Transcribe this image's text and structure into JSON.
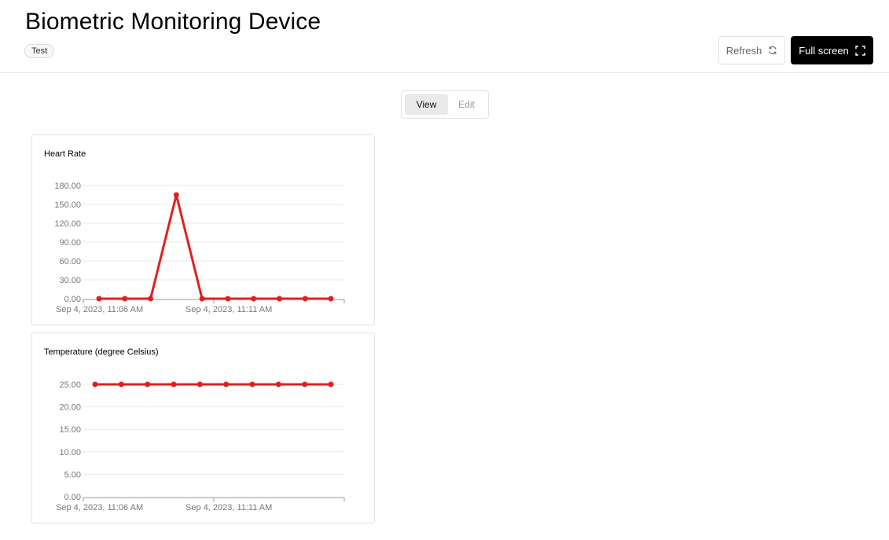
{
  "header": {
    "title": "Biometric Monitoring Device",
    "tag": "Test",
    "refresh_label": "Refresh",
    "fullscreen_label": "Full screen"
  },
  "mode_toggle": {
    "view_label": "View",
    "edit_label": "Edit",
    "active": "View"
  },
  "colors": {
    "series": "#e02020",
    "grid": "#e8e8e8",
    "axis": "#999999"
  },
  "chart_data": [
    {
      "type": "line",
      "title": "Heart Rate",
      "x": [
        "Sep 4, 2023, 11:06 AM",
        "",
        "",
        "",
        "",
        "Sep 4, 2023, 11:11 AM",
        "",
        "",
        "",
        ""
      ],
      "x_tick_labels": [
        "Sep 4, 2023, 11:06 AM",
        "Sep 4, 2023, 11:11 AM"
      ],
      "series": [
        {
          "values": [
            0,
            0,
            0,
            165,
            0,
            0,
            0,
            0,
            0,
            0
          ]
        }
      ],
      "ylim": [
        0,
        180
      ],
      "y_ticks": [
        "0.00",
        "30.00",
        "60.00",
        "90.00",
        "120.00",
        "150.00",
        "180.00"
      ],
      "grid": true
    },
    {
      "type": "line",
      "title": "Temperature (degree Celsius)",
      "x": [
        "Sep 4, 2023, 11:06 AM",
        "",
        "",
        "",
        "",
        "Sep 4, 2023, 11:11 AM",
        "",
        "",
        "",
        ""
      ],
      "x_tick_labels": [
        "Sep 4, 2023, 11:06 AM",
        "Sep 4, 2023, 11:11 AM"
      ],
      "series": [
        {
          "values": [
            25,
            25,
            25,
            25,
            25,
            25,
            25,
            25,
            25,
            25
          ]
        }
      ],
      "ylim": [
        0,
        25
      ],
      "y_ticks": [
        "0.00",
        "5.00",
        "10.00",
        "15.00",
        "20.00",
        "25.00"
      ],
      "grid": true
    }
  ]
}
